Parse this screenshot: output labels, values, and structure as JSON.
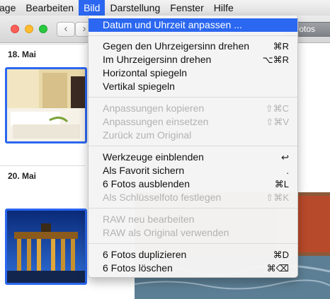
{
  "menubar": {
    "items": [
      "age",
      "Bearbeiten",
      "Bild",
      "Darstellung",
      "Fenster",
      "Hilfe"
    ]
  },
  "toolbar": {
    "back": "‹",
    "forward": "›",
    "segment_label": "Fotos"
  },
  "sections": {
    "date1": "18. Mai",
    "date2": "20. Mai"
  },
  "menu": {
    "items": [
      {
        "label": "Datum und Uhrzeit anpassen ...",
        "shortcut": ""
      },
      {
        "label": "Gegen den Uhrzeigersinn drehen",
        "shortcut": "⌘R"
      },
      {
        "label": "Im Uhrzeigersinn drehen",
        "shortcut": "⌥⌘R"
      },
      {
        "label": "Horizontal spiegeln",
        "shortcut": ""
      },
      {
        "label": "Vertikal spiegeln",
        "shortcut": ""
      },
      {
        "label": "Anpassungen kopieren",
        "shortcut": "⇧⌘C"
      },
      {
        "label": "Anpassungen einsetzen",
        "shortcut": "⇧⌘V"
      },
      {
        "label": "Zurück zum Original",
        "shortcut": ""
      },
      {
        "label": "Werkzeuge einblenden",
        "shortcut": "↩"
      },
      {
        "label": "Als Favorit sichern",
        "shortcut": "."
      },
      {
        "label": "6 Fotos ausblenden",
        "shortcut": "⌘L"
      },
      {
        "label": "Als Schlüsselfoto festlegen",
        "shortcut": "⇧⌘K"
      },
      {
        "label": "RAW neu bearbeiten",
        "shortcut": ""
      },
      {
        "label": "RAW als Original verwenden",
        "shortcut": ""
      },
      {
        "label": "6 Fotos duplizieren",
        "shortcut": "⌘D"
      },
      {
        "label": "6 Fotos löschen",
        "shortcut": "⌘⌫"
      }
    ]
  },
  "colors": {
    "accent": "#2b67f0",
    "disabled_text": "#b2b2b2"
  }
}
